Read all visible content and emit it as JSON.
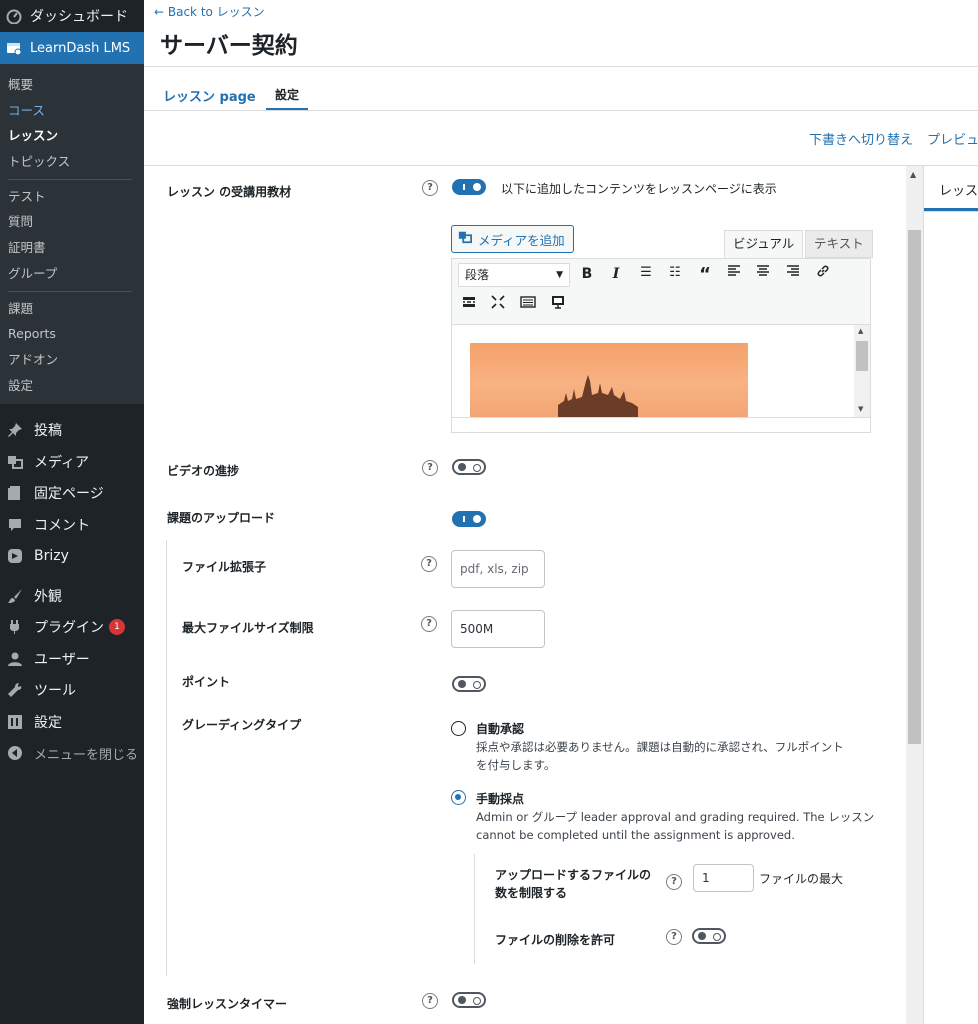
{
  "sidebar": {
    "dashboard": "ダッシュボード",
    "learndash": "LearnDash LMS",
    "sub_items": [
      "概要",
      "コース",
      "レッスン",
      "トピックス",
      "テスト",
      "質問",
      "証明書",
      "グループ",
      "課題",
      "Reports",
      "アドオン",
      "設定"
    ],
    "main_items": [
      "投稿",
      "メディア",
      "固定ページ",
      "コメント",
      "Brizy",
      "外観",
      "プラグイン",
      "ユーザー",
      "ツール",
      "設定"
    ],
    "plugin_badge": "1",
    "collapse": "メニューを閉じる"
  },
  "header": {
    "back": "← Back to レッスン",
    "title": "サーバー契約",
    "tab_lesson": "レッスン page",
    "tab_settings": "設定"
  },
  "toolbar": {
    "draft": "下書きへ切り替え",
    "preview": "プレビュー"
  },
  "settings": {
    "materials_label": "レッスン の受講用教材",
    "materials_desc": "以下に追加したコンテンツをレッスンページに表示",
    "add_media": "メディアを追加",
    "tab_visual": "ビジュアル",
    "tab_text": "テキスト",
    "format": "段落",
    "video_label": "ビデオの進捗",
    "upload_label": "課題のアップロード",
    "ext_label": "ファイル拡張子",
    "ext_placeholder": "pdf, xls, zip",
    "maxsize_label": "最大ファイルサイズ制限",
    "maxsize_value": "500M",
    "points_label": "ポイント",
    "grading_label": "グレーディングタイプ",
    "auto_label": "自動承認",
    "auto_desc_1": "採点や承認は必要ありません。課題は自動的に承認され、フルポイント",
    "auto_desc_2": "を付与します。",
    "manual_label": "手動採点",
    "manual_desc_1": "Admin or グループ leader approval and grading required. The レッスン",
    "manual_desc_2": "cannot be completed until the assignment is approved.",
    "limit_label_1": "アップロードするファイルの",
    "limit_label_2": "数を制限する",
    "limit_value": "1",
    "limit_suffix": "ファイルの最大",
    "delete_label": "ファイルの削除を許可",
    "timer_label": "強制レッスンタイマー"
  },
  "right_panel": {
    "tab": "レッスン"
  },
  "colors": {
    "accent": "#2271b1",
    "sidebar_bg": "#1d2327",
    "badge": "#d63638"
  }
}
